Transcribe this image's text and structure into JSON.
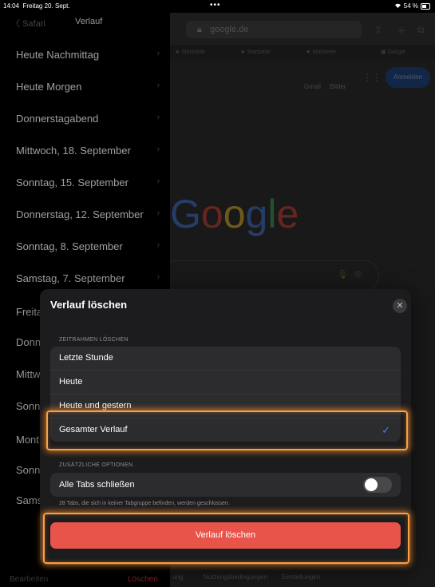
{
  "status_bar": {
    "time": "14:04",
    "date": "Freitag 20. Sept.",
    "dots": "•••",
    "wifi": "wifi-icon",
    "battery": "54 %"
  },
  "browser": {
    "url": "google.de",
    "favorites": [
      "Startseite",
      "Startseite",
      "Startseite",
      "Google"
    ],
    "google_links": [
      "Gmail",
      "Bilder"
    ],
    "sign_in": "Anmelden",
    "logo": "Google",
    "footer_links": [
      "ung",
      "Nutzungsbedingungen",
      "Einstellungen"
    ]
  },
  "sidebar": {
    "back_label": "Safari",
    "title": "Verlauf",
    "items": [
      "Heute Nachmittag",
      "Heute Morgen",
      "Donnerstagabend",
      "Mittwoch, 18. September",
      "Sonntag, 15. September",
      "Donnerstag, 12. September",
      "Sonntag, 8. September",
      "Samstag, 7. September",
      "Freita",
      "Donn",
      "Mittw",
      "Sonn",
      "Mont",
      "Sonn",
      "Sams"
    ],
    "edit_label": "Bearbeiten",
    "delete_label": "Löschen"
  },
  "modal": {
    "title": "Verlauf löschen",
    "close_icon": "close-icon",
    "timeframe_header": "ZEITRAHMEN LÖSCHEN",
    "options": [
      "Letzte Stunde",
      "Heute",
      "Heute und gestern",
      "Gesamter Verlauf"
    ],
    "selected_option": "Gesamter Verlauf",
    "check_glyph": "✓",
    "extra_header": "ZUSÄTZLICHE OPTIONEN",
    "close_tabs_label": "Alle Tabs schließen",
    "close_tabs_enabled": false,
    "note": "28 Tabs, die sich in keiner Tabgruppe befinden, werden geschlossen.",
    "delete_button": "Verlauf löschen"
  },
  "colors": {
    "accent": "#e9544a",
    "highlight": "#f7a046",
    "check": "#3b82f6"
  }
}
